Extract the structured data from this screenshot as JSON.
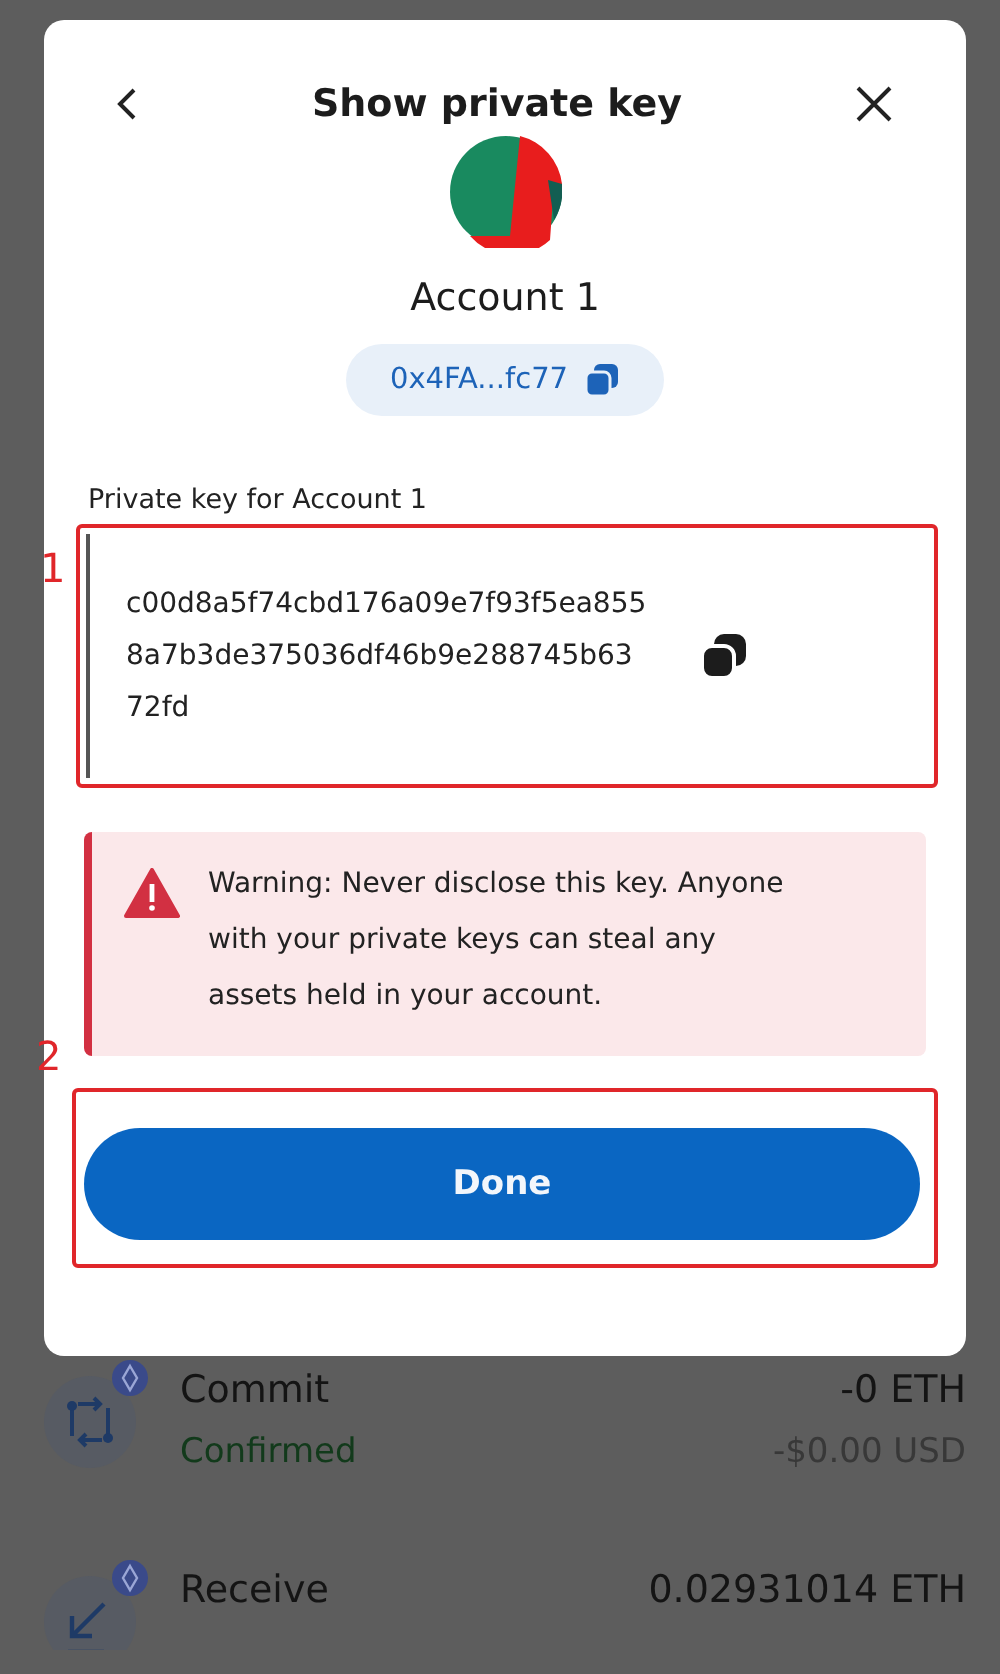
{
  "modal": {
    "title": "Show private key",
    "account_name": "Account 1",
    "address": "0x4FA...fc77",
    "key_label": "Private key for Account 1",
    "private_key": "c00d8a5f74cbd176a09e7f93f5ea8558a7b3de375036df46b9e288745b6372fd",
    "warning": "Warning: Never disclose this key. Anyone with your private keys can steal any assets held in your account.",
    "done_button": "Done"
  },
  "annotations": [
    {
      "label": "1"
    },
    {
      "label": "2"
    }
  ],
  "transactions": [
    {
      "kind": "commit",
      "title": "Commit",
      "status": "Confirmed",
      "amount": "-0 ETH",
      "fiat": "-$0.00 USD"
    },
    {
      "kind": "receive",
      "title": "Receive",
      "amount": "0.02931014 ETH"
    }
  ]
}
